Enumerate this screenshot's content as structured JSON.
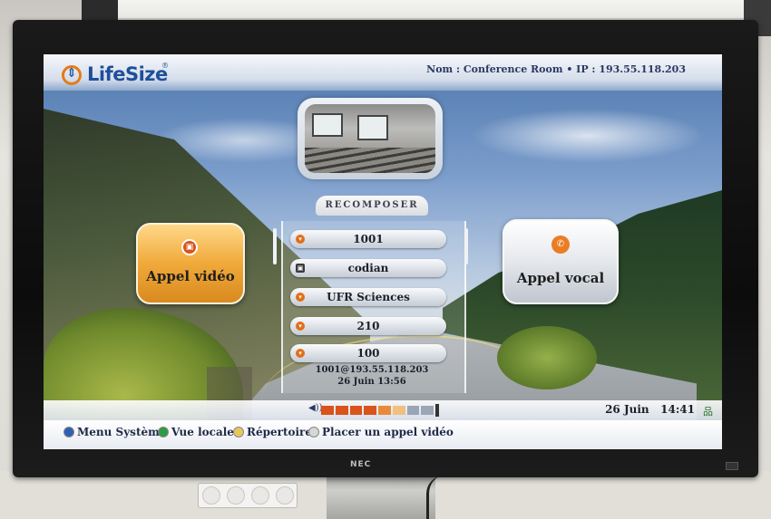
{
  "header": {
    "logo_text": "LifeSize",
    "logo_mark": "®",
    "device_info": "Nom : Conference Room • IP : 193.55.118.203"
  },
  "recompose": {
    "title": "RECOMPOSER",
    "items": [
      {
        "label": "1001",
        "icon": "phone-icon"
      },
      {
        "label": "codian",
        "icon": "video-icon"
      },
      {
        "label": "UFR Sciences",
        "icon": "phone-icon"
      },
      {
        "label": "210",
        "icon": "phone-icon"
      },
      {
        "label": "100",
        "icon": "phone-icon"
      }
    ],
    "last_call_address": "1001@193.55.118.203",
    "last_call_time": "26 Juin   13:56"
  },
  "buttons": {
    "video_label": "Appel vidéo",
    "voice_label": "Appel vocal"
  },
  "status": {
    "date": "26 Juin",
    "time": "14:41",
    "volume_segments": [
      "#d9531b",
      "#d9531b",
      "#d9531b",
      "#d9531b",
      "#e98a3a",
      "#f0c080",
      "#9aa5b5",
      "#9aa5b5",
      "#333333"
    ]
  },
  "menu": {
    "items": [
      {
        "label": "Menu Système",
        "color": "#2f5fb5"
      },
      {
        "label": "Vue locale",
        "color": "#2e9a43"
      },
      {
        "label": "Répertoire",
        "color": "#e7c75a"
      },
      {
        "label": "Placer un appel vidéo",
        "color": "#d6d6d6"
      }
    ]
  },
  "monitor": {
    "brand": "NEC"
  }
}
